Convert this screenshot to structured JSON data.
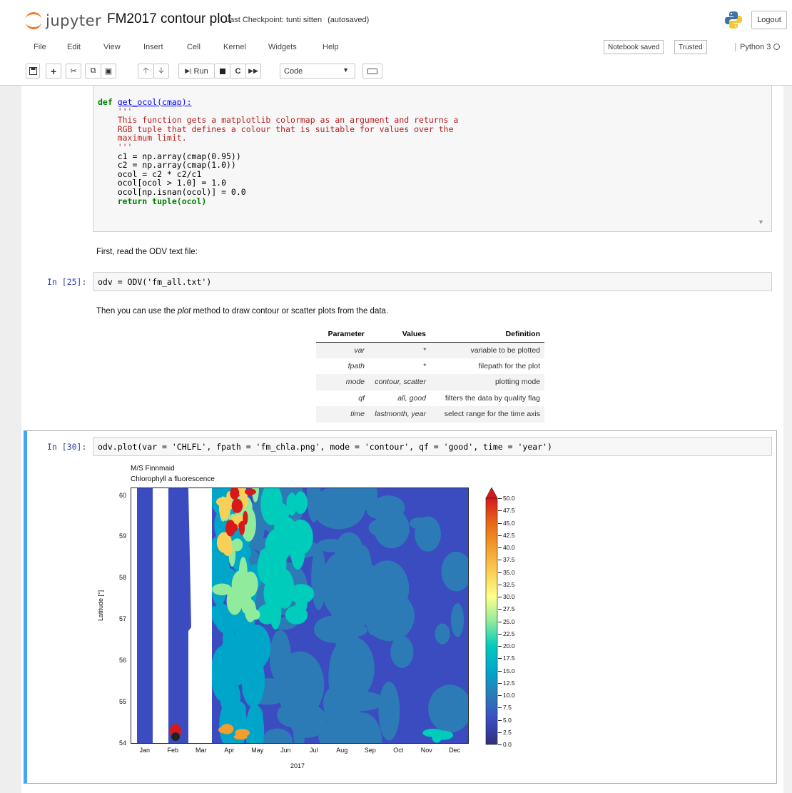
{
  "header": {
    "logo_text": "jupyter",
    "notebook_title": "FM2017 contour plot",
    "checkpoint": "Last Checkpoint: tunti sitten",
    "autosaved": "(autosaved)",
    "logout": "Logout"
  },
  "menu": [
    "File",
    "Edit",
    "View",
    "Insert",
    "Cell",
    "Kernel",
    "Widgets",
    "Help"
  ],
  "status": {
    "notebook_saved": "Notebook saved",
    "trusted": "Trusted",
    "kernel": "Python 3"
  },
  "toolbar": {
    "run_label": "Run",
    "cell_type": "Code"
  },
  "cells": {
    "code1": {
      "lines": [
        "def get_ocol(cmap):",
        "    '''",
        "    This function gets a matplotlib colormap as an argument and returns a",
        "    RGB tuple that defines a colour that is suitable for values over the",
        "    maximum limit.",
        "    '''",
        "    c1 = np.array(cmap(0.95))",
        "    c2 = np.array(cmap(1.0))",
        "    ocol = c2 * c2/c1",
        "    ocol[ocol > 1.0] = 1.0",
        "    ocol[np.isnan(ocol)] = 0.0",
        "    return tuple(ocol)"
      ]
    },
    "md1": "First, read the ODV text file:",
    "in25": {
      "prompt": "In [25]:",
      "code": "odv = ODV('fm_all.txt')"
    },
    "md2": {
      "before": "Then you can use the ",
      "em": "plot",
      "after": " method to draw contour or scatter plots from the data."
    },
    "table": {
      "headers": [
        "Parameter",
        "Values",
        "Definition"
      ],
      "rows": [
        [
          "var",
          "*",
          "variable to be plotted"
        ],
        [
          "fpath",
          "*",
          "filepath for the plot"
        ],
        [
          "mode",
          "contour, scatter",
          "plotting mode"
        ],
        [
          "qf",
          "all, good",
          "filters the data by quality flag"
        ],
        [
          "time",
          "lastmonth, year",
          "select range for the time axis"
        ]
      ]
    },
    "in30": {
      "prompt": "In [30]:",
      "code": "odv.plot(var = 'CHLFL', fpath = 'fm_chla.png', mode = 'contour', qf = 'good', time = 'year')"
    }
  },
  "chart_data": {
    "type": "heatmap",
    "title": "M/S Finnmaid",
    "subtitle": "Chlorophyll a fluorescence",
    "xlabel": "2017",
    "ylabel": "Latitude [°]",
    "x_categories": [
      "Jan",
      "Feb",
      "Mar",
      "Apr",
      "May",
      "Jun",
      "Jul",
      "Aug",
      "Sep",
      "Oct",
      "Nov",
      "Dec"
    ],
    "ylim": [
      54,
      60.2
    ],
    "yticks": [
      "60",
      "59",
      "58",
      "57",
      "56",
      "55",
      "54"
    ],
    "colorbar": {
      "min": 0.0,
      "max": 50.0,
      "ticks": [
        "50.0",
        "47.5",
        "45.0",
        "42.5",
        "40.0",
        "37.5",
        "35.0",
        "32.5",
        "30.0",
        "27.5",
        "25.0",
        "22.5",
        "20.0",
        "17.5",
        "15.0",
        "12.5",
        "10.0",
        "7.5",
        "5.0",
        "2.5",
        "0.0"
      ]
    },
    "colormap": [
      "#3b4cc0",
      "#2c7bb6",
      "#00a6ca",
      "#00ccbc",
      "#90eb9d",
      "#ffff8c",
      "#f9d057",
      "#f29e2e",
      "#e76818",
      "#d7191c"
    ]
  }
}
